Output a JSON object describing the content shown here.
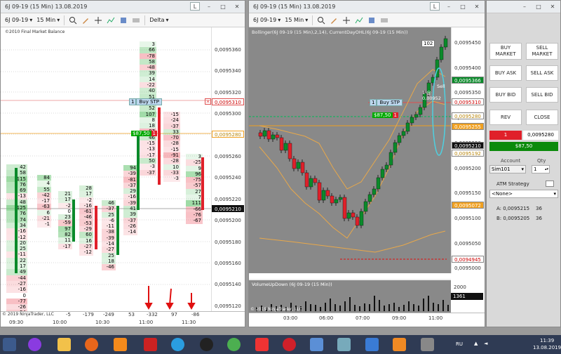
{
  "left_window": {
    "title": "6J 09-19 (15 Min)  13.08.2019",
    "symbol": "6J 09-19",
    "interval": "15 Min",
    "delta_mode": "Delta",
    "watermark": "©2010 Final Market Balance",
    "copyright": "© 2019 NinjaTrader, LLC",
    "price_labels": [
      "0,0095360",
      "0,0095340",
      "0,0095320",
      "0,0095300",
      "0,0095280",
      "0,0095260",
      "0,0095240",
      "0,0095220",
      "0,0095200",
      "0,0095180",
      "0,0095160",
      "0,0095140",
      "0,0095120"
    ],
    "tag_stop": "0,0095310",
    "tag_entry": "0,0095280",
    "tag_last": "0,0095210",
    "buy_stp_qty": "1",
    "buy_stp_label": "Buy STP",
    "position_label": "$87,50",
    "position_qty": "1",
    "time_labels": [
      "09:30",
      "10:00",
      "10:30",
      "11:00",
      "11:30"
    ],
    "bar_deltas": [
      "-5",
      "-179",
      "-249",
      "53",
      "-332",
      "97",
      "-86"
    ],
    "footprint": {
      "col1": [
        "42",
        "58",
        "115",
        "76",
        "69",
        "-13",
        "48",
        "125",
        "76",
        "74",
        "34",
        "-16",
        "-12",
        "20",
        "25",
        "-11",
        "22",
        "17",
        "49",
        "-44",
        "-27",
        "-16",
        "0",
        "-77",
        "-26",
        "-54"
      ],
      "col2": [
        "84",
        "4",
        "55",
        "-42",
        "-17",
        "-63",
        "6",
        "-21",
        "-1"
      ],
      "col3": [
        "21",
        "17",
        "-2",
        "0",
        "23",
        "-59",
        "97",
        "82",
        "11",
        "-17"
      ],
      "col4": [
        "28",
        "17",
        "-2",
        "-16",
        "-61",
        "-46",
        "-53",
        "-29",
        "60",
        "16",
        "-27",
        "-12"
      ],
      "col5": [
        "46",
        "-37",
        "25",
        "-6",
        "-11",
        "-38",
        "-39",
        "-14",
        "-27",
        "25",
        "18",
        "-46"
      ],
      "col6": [
        "94",
        "-39",
        "-81",
        "-37",
        "29",
        "-16",
        "-39",
        "41",
        "39",
        "-37",
        "-26",
        "-14"
      ],
      "col7": [
        "3",
        "66",
        "-78",
        "58",
        "-48",
        "39",
        "14",
        "-22",
        "40",
        "51",
        "44",
        "52",
        "107",
        "8",
        "18",
        "-87",
        "46",
        "-15",
        "-13",
        "-17",
        "50",
        "-3",
        "-37"
      ],
      "col8": [
        "-15",
        "-24",
        "-37",
        "33",
        "-70",
        "-28",
        "-15",
        "-91",
        "-28",
        "10",
        "-33",
        "-3"
      ],
      "col9": [
        "3",
        "-25",
        "9",
        "96",
        "-75",
        "-57",
        "27",
        "7",
        "111",
        "-66",
        "-76",
        "-67"
      ]
    }
  },
  "right_window": {
    "title": "6J 09-19 (15 Min)  13.08.2019",
    "symbol": "6J 09-19",
    "interval": "15 Min",
    "indicator_label": "Bollinger(6J 09-19 (15 Min),2,14), CurrentDayOHL(6J 09-19 (15 Min))",
    "volume_label": "VolumeUpDown (6J 09-19 (15 Min))",
    "copyright": "© 2019 NinjaTrader, LLC",
    "price_labels": [
      "0,0095450",
      "0,0095400",
      "0,0095350",
      "0,0095300",
      "0,0095250",
      "0,0095200",
      "0,0095150",
      "0,0095100",
      "0,0095050",
      "0,0095000"
    ],
    "tag_high": "0,0095366",
    "tag_stop": "0,0095310",
    "tag_entry": "0,0095280",
    "tag_open": "0,0095255",
    "tag_last": "0,0095210",
    "tag_prev": "0,0095192",
    "tag_mid": "0,0095072",
    "tag_low": "0,0094945",
    "volume_scale": "2000",
    "volume_last": "1361",
    "badge_102": "102",
    "sell_note": "Sell",
    "sell_fill": "1 @ 0,00952",
    "buy_stp_qty": "1",
    "buy_stp_label": "Buy STP",
    "position_label": "$87,50",
    "position_qty": "1",
    "time_labels": [
      "03:00",
      "06:00",
      "07:00",
      "09:00",
      "11:00"
    ]
  },
  "order_panel": {
    "buy_market": "BUY\nMARKET",
    "sell_market": "SELL\nMARKET",
    "buy_ask": "BUY ASK",
    "sell_ask": "SELL ASK",
    "buy_bid": "BUY BID",
    "sell_bid": "SELL BID",
    "rev": "REV",
    "close": "CLOSE",
    "position_qty": "1",
    "position_price": "0,0095280",
    "pnl": "$87,50",
    "account_label": "Account",
    "account_value": "Sim101",
    "qty_label": "Qty",
    "qty_value": "1",
    "atm_label": "ATM Strategy",
    "atm_value": "<None>",
    "ask_label": "A: 0,0095215",
    "ask_size": "36",
    "bid_label": "B: 0,0095205",
    "bid_size": "36"
  },
  "taskbar": {
    "language": "RU",
    "time": "11:39",
    "date": "13.08.2019"
  },
  "colors": {
    "green": "#0a8a2a",
    "red": "#e0202a",
    "orange": "#f0a020",
    "pnl_bg": "#0b8a0b",
    "chart_bg": "#898989"
  }
}
